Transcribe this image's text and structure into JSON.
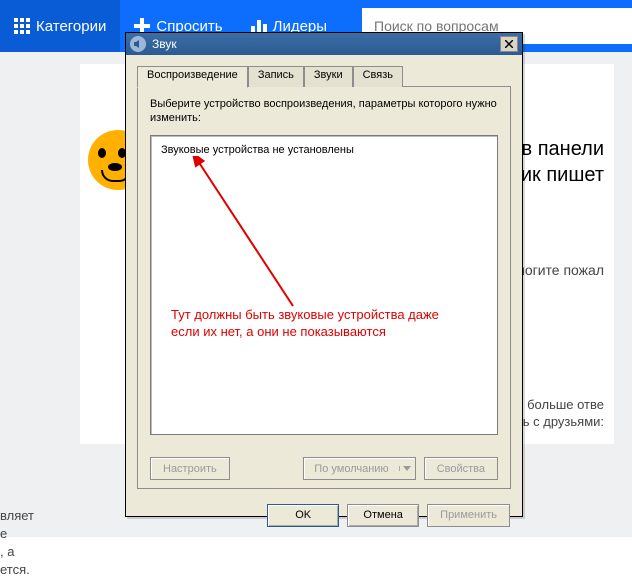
{
  "nav": {
    "categories": "Категории",
    "ask": "Спросить",
    "leaders": "Лидеры",
    "search_placeholder": "Поиск по вопросам"
  },
  "bg": {
    "title_frag1": "в панели",
    "title_frag2": "ик пишет",
    "help": "помогите пожал",
    "more1": "ть больше отве",
    "more2": "сь с друзьями:",
    "bottom": "вляет\nе\n, а\nется."
  },
  "dialog": {
    "title": "Звук",
    "tabs": [
      "Воспроизведение",
      "Запись",
      "Звуки",
      "Связь"
    ],
    "active_tab": 0,
    "hint": "Выберите устройство воспроизведения, параметры которого нужно изменить:",
    "device_msg": "Звуковые устройства не установлены",
    "annotation": "Тут должны быть звуковые устройства даже если их нет, а они не показываются",
    "buttons": {
      "configure": "Настроить",
      "default": "По умолчанию",
      "properties": "Свойства",
      "ok": "OK",
      "cancel": "Отмена",
      "apply": "Применить"
    }
  }
}
